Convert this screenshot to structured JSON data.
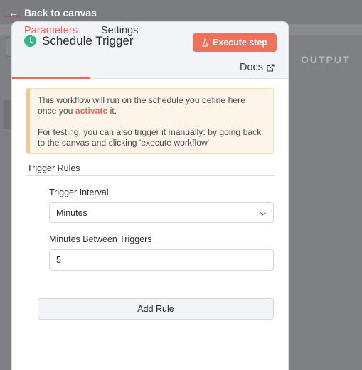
{
  "nav": {
    "back_label": "Back to canvas"
  },
  "output_pane": {
    "title": "OUTPUT"
  },
  "node": {
    "title": "Schedule Trigger",
    "icon": "clock-icon",
    "execute_label": "Execute step"
  },
  "tabs": [
    {
      "label": "Parameters",
      "active": true
    },
    {
      "label": "Settings",
      "active": false
    }
  ],
  "docs": {
    "label": "Docs",
    "icon": "external-link-icon"
  },
  "notice": {
    "line1_before": "This workflow will run on the schedule you define here once you ",
    "line1_link": "activate",
    "line1_after": " it.",
    "line2": "For testing, you can also trigger it manually: by going back to the canvas and clicking 'execute workflow'"
  },
  "trigger_rules": {
    "section_title": "Trigger Rules",
    "interval_label": "Trigger Interval",
    "interval_value": "Minutes",
    "minutes_label": "Minutes Between Triggers",
    "minutes_value": "5",
    "add_rule_label": "Add Rule"
  },
  "colors": {
    "accent": "#ee6a55",
    "execute_button": "#f1705a",
    "node_icon": "#31b87f",
    "notice_bg": "#fdf5ea",
    "notice_border": "#f2c98a"
  }
}
